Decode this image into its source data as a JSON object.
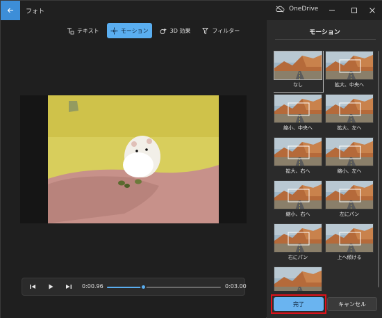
{
  "window": {
    "title": "フォト"
  },
  "cloud": {
    "label": "OneDrive"
  },
  "toolbar": {
    "items": [
      {
        "label": "テキスト",
        "icon": "text-icon"
      },
      {
        "label": "モーション",
        "icon": "motion-icon",
        "active": true
      },
      {
        "label": "3D 効果",
        "icon": "3d-effect-icon"
      },
      {
        "label": "フィルター",
        "icon": "filter-icon"
      }
    ]
  },
  "player": {
    "current_time": "0:00.96",
    "total_time": "0:03.00",
    "progress": 0.32
  },
  "panel": {
    "title": "モーション",
    "motions": [
      {
        "label": "なし",
        "selected": true
      },
      {
        "label": "拡大、中央へ"
      },
      {
        "label": "縮小、中央へ"
      },
      {
        "label": "拡大、左へ"
      },
      {
        "label": "拡大、右へ"
      },
      {
        "label": "縮小、左へ"
      },
      {
        "label": "縮小、右へ"
      },
      {
        "label": "左にパン"
      },
      {
        "label": "右にパン"
      },
      {
        "label": "上へ傾ける"
      },
      {
        "label": ""
      }
    ],
    "done_label": "完了",
    "cancel_label": "キャンセル"
  },
  "colors": {
    "accent": "#5aaef0",
    "highlight": "#e0121b",
    "titlebar_back": "#3d8ed8"
  }
}
